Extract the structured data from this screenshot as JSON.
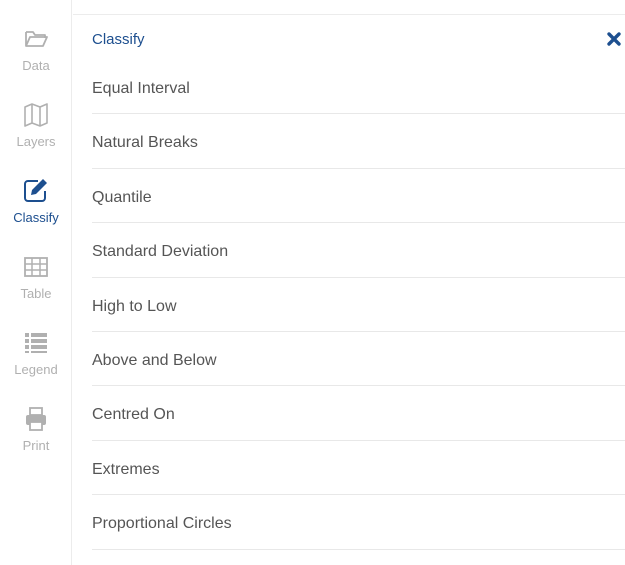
{
  "sidebar": {
    "items": [
      {
        "label": "Data",
        "icon": "folder-icon"
      },
      {
        "label": "Layers",
        "icon": "map-icon"
      },
      {
        "label": "Classify",
        "icon": "edit-icon",
        "active": true
      },
      {
        "label": "Table",
        "icon": "table-icon"
      },
      {
        "label": "Legend",
        "icon": "list-icon"
      },
      {
        "label": "Print",
        "icon": "print-icon"
      }
    ]
  },
  "panel": {
    "title": "Classify",
    "close_icon": "close-icon",
    "items": [
      "Equal Interval",
      "Natural Breaks",
      "Quantile",
      "Standard Deviation",
      "High to Low",
      "Above and Below",
      "Centred On",
      "Extremes",
      "Proportional Circles"
    ]
  },
  "colors": {
    "accent": "#1d4f8f",
    "inactive": "#b0b0b0",
    "text": "#555555",
    "divider": "#e8e8e8"
  }
}
